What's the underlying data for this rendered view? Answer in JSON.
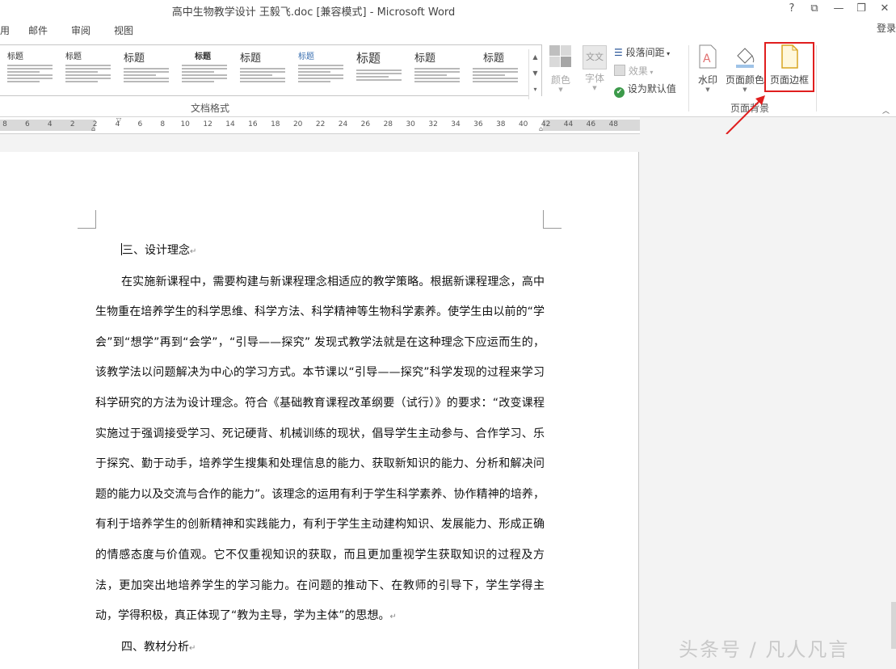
{
  "window": {
    "title": "高中生物教学设计 王毅飞.doc [兼容模式] - Microsoft Word",
    "controls": {
      "help": "?",
      "ribbon_opts": "⧉",
      "minimize": "—",
      "restore": "❐",
      "close": "✕"
    }
  },
  "tabs": [
    "用",
    "邮件",
    "审阅",
    "视图"
  ],
  "account": {
    "login": "登录"
  },
  "ribbon": {
    "doc_format_label": "文档格式",
    "page_background_label": "页面背景",
    "style_gallery": [
      {
        "head": "标题"
      },
      {
        "head": "标题"
      },
      {
        "head": "标题"
      },
      {
        "head": "标题"
      },
      {
        "head": "标题"
      },
      {
        "head": "标题"
      },
      {
        "head": "标题"
      },
      {
        "head": "标题"
      },
      {
        "head": "标题"
      }
    ],
    "colors_label": "颜色",
    "fonts_label": "字体",
    "fonts_icon_text": "文文",
    "paragraph_spacing": "段落间距",
    "effects": "效果",
    "set_default": "设为默认值",
    "watermark": "水印",
    "page_color": "页面颜色",
    "page_borders": "页面边框",
    "colors": {
      "highlight": "#e01e1e",
      "accent": "#2b579a"
    }
  },
  "ruler": {
    "numbers": [
      "8",
      "6",
      "4",
      "2",
      "2",
      "4",
      "6",
      "8",
      "10",
      "12",
      "14",
      "16",
      "18",
      "20",
      "22",
      "24",
      "26",
      "28",
      "30",
      "32",
      "34",
      "36",
      "38",
      "40",
      "42",
      "44",
      "46",
      "48"
    ]
  },
  "document": {
    "heading3": "三、设计理念",
    "paragraph": "在实施新课程中，需要构建与新课程理念相适应的教学策略。根据新课程理念，高中生物重在培养学生的科学思维、科学方法、科学精神等生物科学素养。使学生由以前的“学会”到“想学”再到“会学”，“引导——探究” 发现式教学法就是在这种理念下应运而生的，该教学法以问题解决为中心的学习方式。本节课以“引导——探究”科学发现的过程来学习科学研究的方法为设计理念。符合《基础教育课程改革纲要（试行）》的要求：“改变课程实施过于强调接受学习、死记硬背、机械训练的现状，倡导学生主动参与、合作学习、乐于探究、勤于动手，培养学生搜集和处理信息的能力、获取新知识的能力、分析和解决问题的能力以及交流与合作的能力”。该理念的运用有利于学生科学素养、协作精神的培养，有利于培养学生的创新精神和实践能力，有利于学生主动建构知识、发展能力、形成正确的情感态度与价值观。它不仅重视知识的获取，而且更加重视学生获取知识的过程及方法，更加突出地培养学生的学习能力。在问题的推动下、在教师的引导下，学生学得主动，学得积极，真正体现了“教为主导，学为主体”的思想。",
    "heading4": "四、教材分析",
    "para_mark": "↵"
  },
  "watermark_text": "头条号 / 凡人凡言"
}
